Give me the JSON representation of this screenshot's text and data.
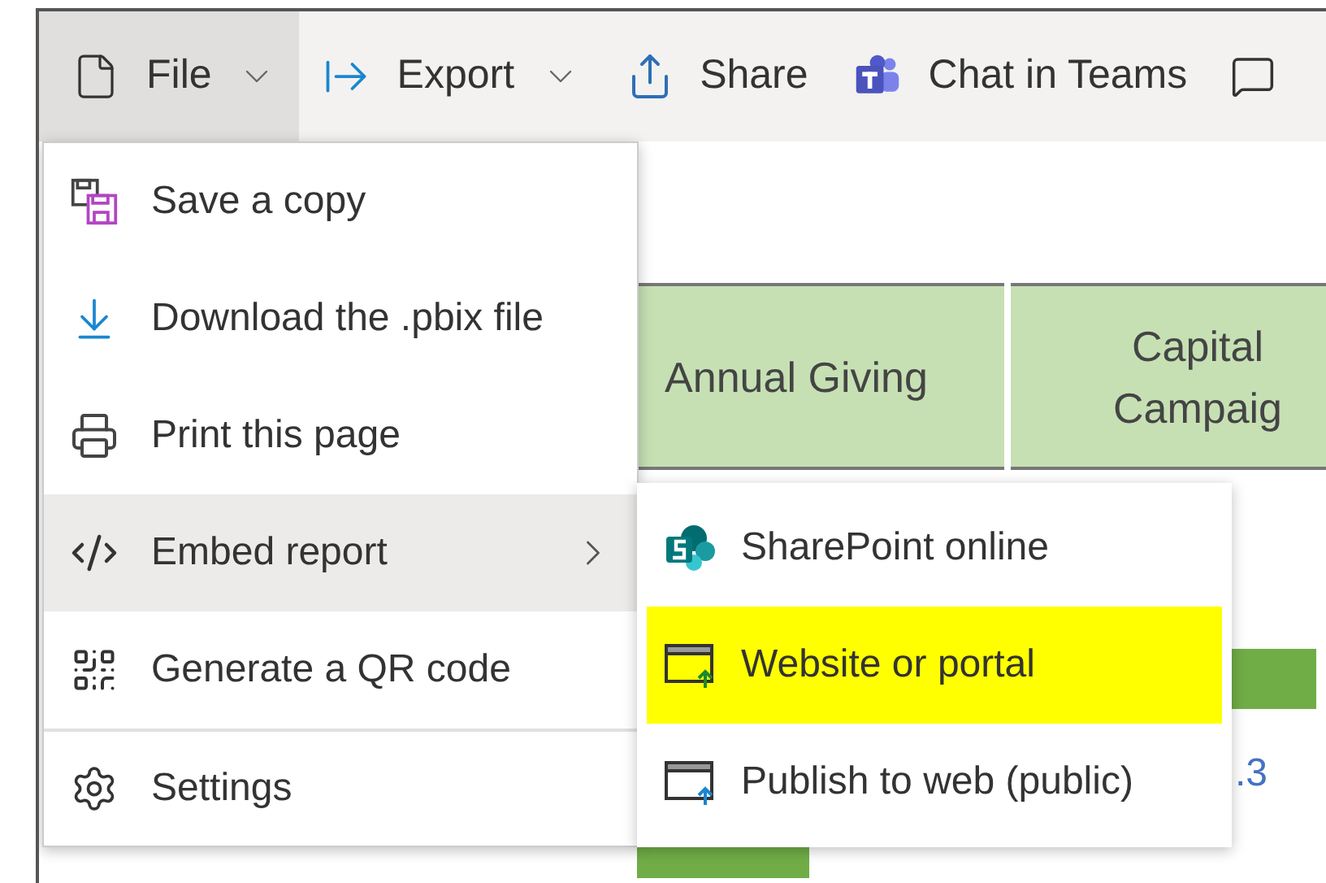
{
  "toolbar": {
    "items": [
      {
        "label": "File",
        "kind": "menu",
        "selected": true
      },
      {
        "label": "Export",
        "kind": "menu",
        "selected": false
      },
      {
        "label": "Share",
        "kind": "button",
        "selected": false
      },
      {
        "label": "Chat in Teams",
        "kind": "button",
        "selected": false
      }
    ]
  },
  "file_menu": {
    "items": [
      {
        "label": "Save a copy",
        "selected": false,
        "submenu": false,
        "separated": false
      },
      {
        "label": "Download the .pbix file",
        "selected": false,
        "submenu": false,
        "separated": false
      },
      {
        "label": "Print this page",
        "selected": false,
        "submenu": false,
        "separated": false
      },
      {
        "label": "Embed report",
        "selected": true,
        "submenu": true,
        "separated": false
      },
      {
        "label": "Generate a QR code",
        "selected": false,
        "submenu": false,
        "separated": false
      },
      {
        "label": "Settings",
        "selected": false,
        "submenu": false,
        "separated": true
      }
    ]
  },
  "embed_submenu": {
    "items": [
      {
        "label": "SharePoint online",
        "highlighted": false
      },
      {
        "label": "Website or portal",
        "highlighted": true
      },
      {
        "label": "Publish to web (public)",
        "highlighted": false
      }
    ]
  },
  "table": {
    "columns": [
      "Annual Giving",
      "Capital Campaig"
    ],
    "cell": ".3"
  }
}
